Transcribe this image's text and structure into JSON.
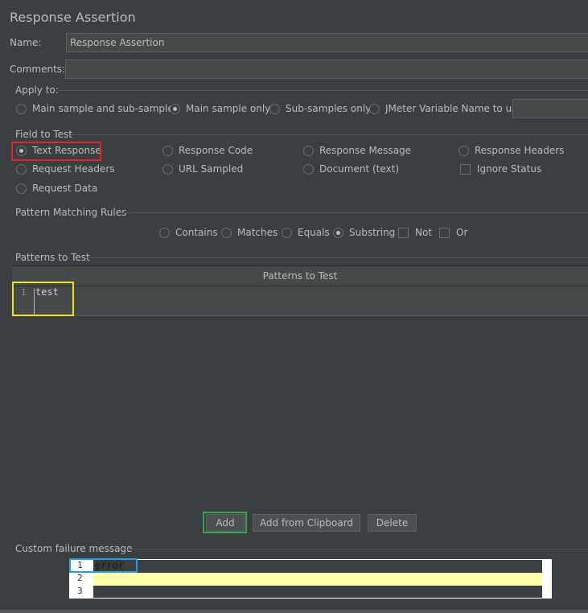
{
  "panel": {
    "title": "Response Assertion"
  },
  "name_field": {
    "label": "Name:",
    "value": "Response Assertion"
  },
  "comments_field": {
    "label": "Comments:",
    "value": ""
  },
  "apply_to": {
    "title": "Apply to:",
    "options": [
      {
        "label": "Main sample and sub-samples",
        "selected": false
      },
      {
        "label": "Main sample only",
        "selected": true
      },
      {
        "label": "Sub-samples only",
        "selected": false
      },
      {
        "label": "JMeter Variable Name to use",
        "selected": false
      }
    ],
    "variable_value": ""
  },
  "field_to_test": {
    "title": "Field to Test",
    "options": [
      {
        "label": "Text Response",
        "selected": true
      },
      {
        "label": "Response Code",
        "selected": false
      },
      {
        "label": "Response Message",
        "selected": false
      },
      {
        "label": "Response Headers",
        "selected": false
      },
      {
        "label": "Request Headers",
        "selected": false
      },
      {
        "label": "URL Sampled",
        "selected": false
      },
      {
        "label": "Document (text)",
        "selected": false
      },
      {
        "label": "Request Data",
        "selected": false
      }
    ],
    "ignore_status": {
      "label": "Ignore Status",
      "checked": false
    }
  },
  "pattern_rules": {
    "title": "Pattern Matching Rules",
    "options": [
      {
        "label": "Contains",
        "selected": false
      },
      {
        "label": "Matches",
        "selected": false
      },
      {
        "label": "Equals",
        "selected": false
      },
      {
        "label": "Substring",
        "selected": true
      }
    ],
    "not": {
      "label": "Not",
      "checked": false
    },
    "or": {
      "label": "Or",
      "checked": false
    }
  },
  "patterns": {
    "title": "Patterns to Test",
    "column_header": "Patterns to Test",
    "rows": [
      {
        "line": "1",
        "value": "test"
      }
    ]
  },
  "buttons": {
    "add": "Add",
    "add_clipboard": "Add from Clipboard",
    "delete": "Delete"
  },
  "custom_failure": {
    "title": "Custom failure message",
    "lines": [
      {
        "num": "1",
        "text": "error"
      },
      {
        "num": "2",
        "text": ""
      },
      {
        "num": "3",
        "text": ""
      }
    ]
  },
  "highlight_colors": {
    "red": "#e0262a",
    "yellow": "#f0e11c",
    "green": "#2fa84f",
    "blue": "#1fa2e8"
  }
}
